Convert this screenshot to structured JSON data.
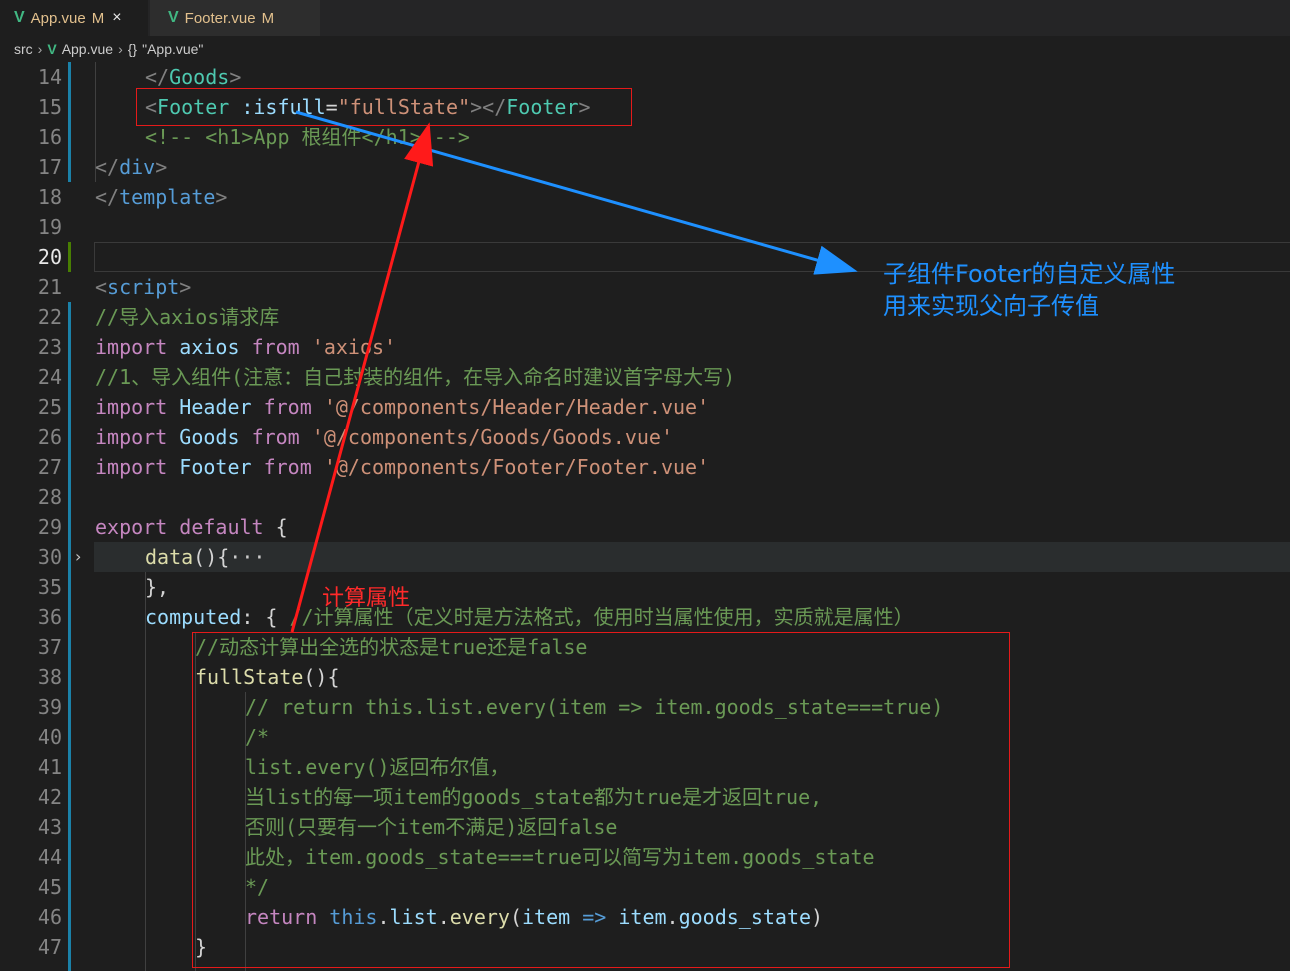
{
  "tabs": [
    {
      "label": "App.vue",
      "status": "M",
      "close": "×"
    },
    {
      "label": "Footer.vue",
      "status": "M"
    }
  ],
  "breadcrumb": {
    "folder": "src",
    "file": "App.vue",
    "symbol_icon": "{}",
    "symbol": "\"App.vue\""
  },
  "lines": [
    {
      "n": "14"
    },
    {
      "n": "15"
    },
    {
      "n": "16"
    },
    {
      "n": "17"
    },
    {
      "n": "18"
    },
    {
      "n": "19"
    },
    {
      "n": "20"
    },
    {
      "n": "21"
    },
    {
      "n": "22"
    },
    {
      "n": "23"
    },
    {
      "n": "24"
    },
    {
      "n": "25"
    },
    {
      "n": "26"
    },
    {
      "n": "27"
    },
    {
      "n": "28"
    },
    {
      "n": "29"
    },
    {
      "n": "30"
    },
    {
      "n": "35"
    },
    {
      "n": "36"
    },
    {
      "n": "37"
    },
    {
      "n": "38"
    },
    {
      "n": "39"
    },
    {
      "n": "40"
    },
    {
      "n": "41"
    },
    {
      "n": "42"
    },
    {
      "n": "43"
    },
    {
      "n": "44"
    },
    {
      "n": "45"
    },
    {
      "n": "46"
    },
    {
      "n": "47"
    }
  ],
  "code": {
    "l14": {
      "open": "</",
      "tag": "Goods",
      "close": ">"
    },
    "l15": {
      "lt": "<",
      "tag": "Footer",
      "attr": ":isfull",
      "eq": "=",
      "val": "\"fullState\"",
      "gt": "></",
      "tag2": "Footer",
      "end": ">"
    },
    "l16": {
      "comment": "<!-- <h1>App 根组件</h1> -->"
    },
    "l17": {
      "open": "</",
      "tag": "div",
      "close": ">"
    },
    "l18": {
      "open": "</",
      "tag": "template",
      "close": ">"
    },
    "l21": {
      "open": "<",
      "tag": "script",
      "close": ">"
    },
    "l22": {
      "comment": "//导入axios请求库"
    },
    "l23": {
      "kw": "import",
      "name": "axios",
      "from": "from",
      "str": "'axios'"
    },
    "l24": {
      "comment": "//1、导入组件(注意：自己封装的组件，在导入命名时建议首字母大写)"
    },
    "l25": {
      "kw": "import",
      "name": "Header",
      "from": "from",
      "str": "'@/components/Header/Header.vue'"
    },
    "l26": {
      "kw": "import",
      "name": "Goods",
      "from": "from",
      "str": "'@/components/Goods/Goods.vue'"
    },
    "l27": {
      "kw": "import",
      "name": "Footer",
      "from": "from",
      "str": "'@/components/Footer/Footer.vue'"
    },
    "l29": {
      "kw": "export",
      "kw2": "default",
      "brace": "{"
    },
    "l30": {
      "fn": "data",
      "paren": "(){",
      "fold": "···"
    },
    "l35": {
      "text": "},"
    },
    "l36": {
      "key": "computed",
      "colon": ": {",
      "comment": "//计算属性（定义时是方法格式，使用时当属性使用，实质就是属性）"
    },
    "l37": {
      "comment": "//动态计算出全选的状态是true还是false"
    },
    "l38": {
      "fn": "fullState",
      "paren": "(){"
    },
    "l39": {
      "comment": "// return this.list.every(item => item.goods_state===true)"
    },
    "l40": {
      "comment": "/*"
    },
    "l41": {
      "comment": "list.every()返回布尔值，"
    },
    "l42": {
      "comment": "当list的每一项item的goods_state都为true是才返回true,"
    },
    "l43": {
      "comment": "否则(只要有一个item不满足)返回false"
    },
    "l44": {
      "comment": "此处，item.goods_state===true可以简写为item.goods_state"
    },
    "l45": {
      "comment": "*/"
    },
    "l46": {
      "kw": "return",
      "this": "this",
      "dot1": ".",
      "list": "list",
      "dot2": ".",
      "fn": "every",
      "po": "(",
      "item": "item",
      "arrow": "=>",
      "item2": "item",
      "dot3": ".",
      "prop": "goods_state",
      "pc": ")"
    },
    "l47": {
      "text": "}"
    }
  },
  "annotations": {
    "blue_note": [
      "子组件Footer的自定义属性",
      "用来实现父向子传值"
    ],
    "red_note": "计算属性"
  },
  "colors": {
    "editor_bg": "#1e1e1e",
    "annotation_red": "#e51a1a",
    "annotation_blue": "#1e90ff",
    "vue_green": "#41b883",
    "modified": "#e2c08d"
  }
}
